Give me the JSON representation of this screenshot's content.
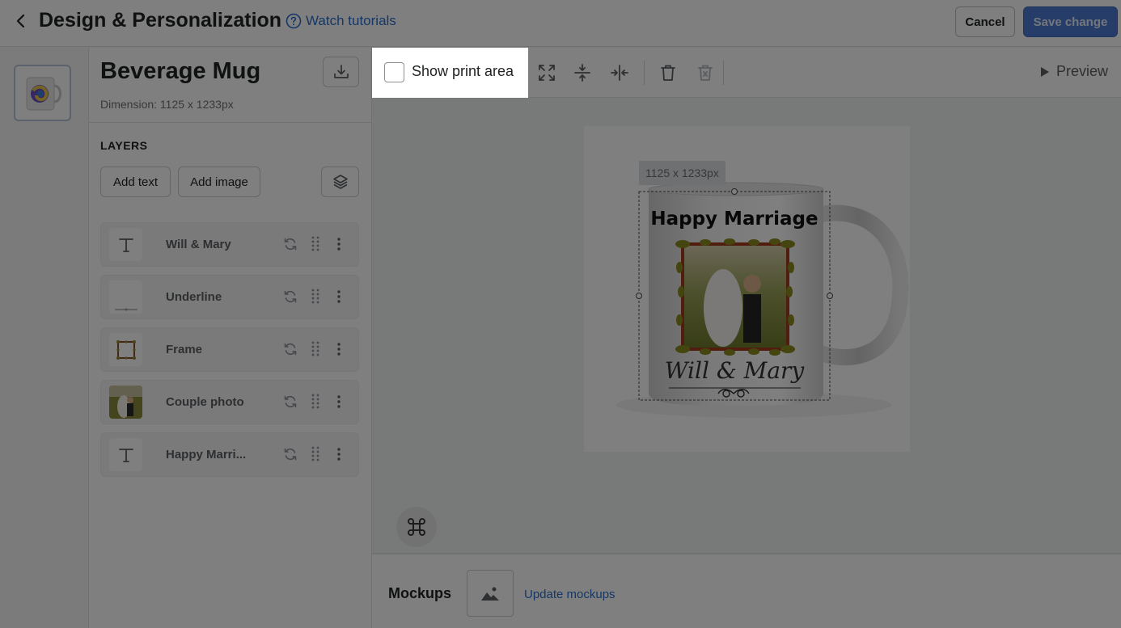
{
  "header": {
    "title": "Design & Personalization",
    "tutorial_label": "Watch tutorials",
    "cancel_label": "Cancel",
    "save_label": "Save change"
  },
  "product": {
    "name": "Beverage Mug",
    "dimension": "Dimension: 1125 x 1233px"
  },
  "layers": {
    "title": "LAYERS",
    "add_text_label": "Add text",
    "add_image_label": "Add image",
    "items": [
      {
        "label": "Will & Mary",
        "icon": "text-icon"
      },
      {
        "label": "Underline",
        "icon": "underline-thumb"
      },
      {
        "label": "Frame",
        "icon": "frame-thumb"
      },
      {
        "label": "Couple photo",
        "icon": "photo-thumb"
      },
      {
        "label": "Happy Marri...",
        "icon": "text-icon"
      }
    ]
  },
  "toolbar": {
    "show_print_area_label": "Show print area",
    "preview_label": "Preview"
  },
  "canvas": {
    "dimension_badge": "1125 x 1233px",
    "mug_title": "Happy Marriage",
    "mug_names": "Will & Mary"
  },
  "mockups": {
    "title": "Mockups",
    "update_label": "Update mockups"
  },
  "colors": {
    "primary": "#4a7bd0",
    "link": "#2c6ecb",
    "overlay": "rgba(0,0,0,0.5)"
  }
}
